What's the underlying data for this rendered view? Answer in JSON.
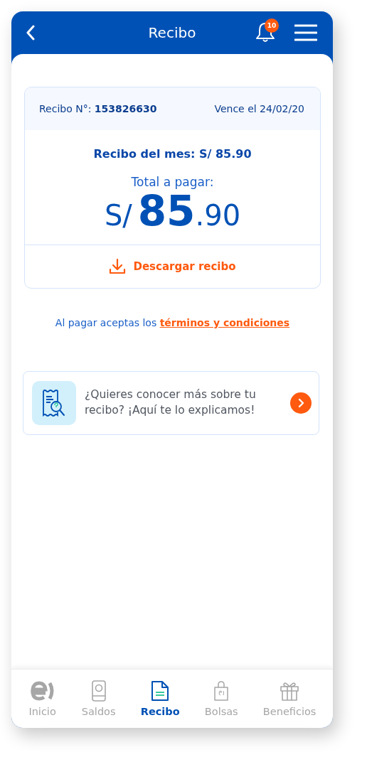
{
  "header": {
    "title": "Recibo",
    "notification_count": "10"
  },
  "receipt": {
    "number_label": "Recibo N°:",
    "number": "153826630",
    "due": "Vence el 24/02/20",
    "monthly": "Recibo del mes: S/ 85.90",
    "total_label": "Total a pagar:",
    "currency": "S/",
    "amount_integer": "85",
    "amount_decimal": ".90",
    "download": "Descargar recibo"
  },
  "terms": {
    "text": "Al pagar aceptas los",
    "link": "términos y condiciones"
  },
  "info_card": {
    "text": "¿Quieres conocer más sobre tu recibo? ¡Aquí te lo explicamos!"
  },
  "tabs": [
    {
      "kind": "home",
      "label": "Inicio",
      "selected": false
    },
    {
      "kind": "phone",
      "label": "Saldos",
      "selected": false
    },
    {
      "kind": "doc",
      "label": "Recibo",
      "selected": true
    },
    {
      "kind": "bag",
      "label": "Bolsas",
      "selected": false
    },
    {
      "kind": "gift",
      "label": "Beneficios",
      "selected": false
    }
  ]
}
